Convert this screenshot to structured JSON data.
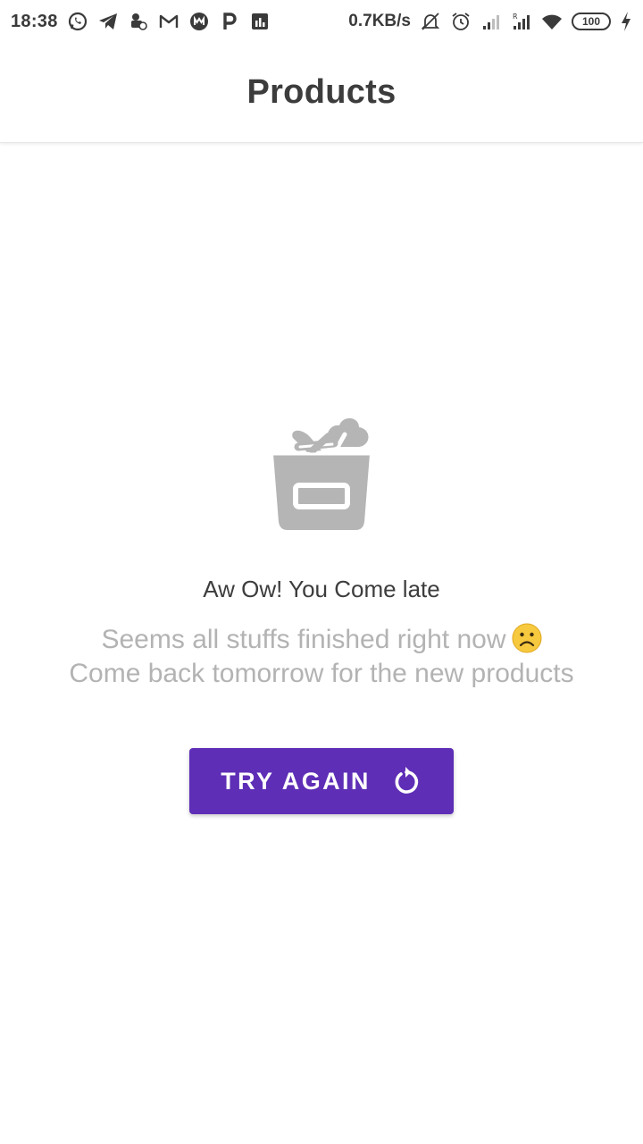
{
  "status_bar": {
    "time": "18:38",
    "network_speed": "0.7KB/s",
    "battery_level": "100",
    "left_icons": [
      "whatsapp-icon",
      "telegram-icon",
      "bell-app-icon",
      "gmail-icon",
      "media-app-icon",
      "p-app-icon",
      "stats-app-icon"
    ],
    "right_icons": [
      "muted-bell-icon",
      "alarm-icon",
      "signal-icon",
      "roaming-signal-icon",
      "wifi-icon",
      "battery-icon",
      "charging-icon"
    ]
  },
  "app_bar": {
    "title": "Products"
  },
  "empty_state": {
    "icon": "grocery-basket-icon",
    "headline": "Aw Ow! You Come late",
    "subtext_line1": "Seems all stuffs finished right now",
    "subtext_line2": "Come back tomorrow for the new products",
    "emoji": "sad-face-emoji"
  },
  "retry_button": {
    "label": "TRY AGAIN",
    "icon": "refresh-icon",
    "color": "#5e2eb6"
  }
}
